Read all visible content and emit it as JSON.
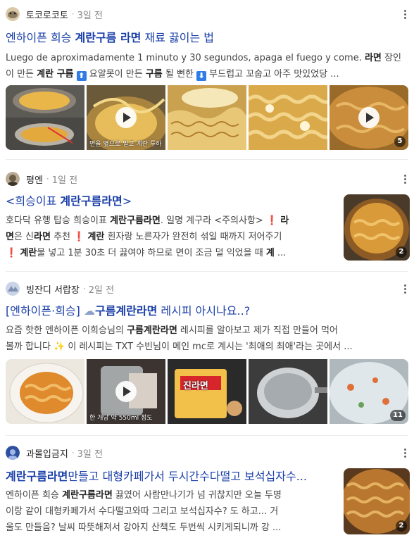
{
  "posts": [
    {
      "author": "토코로코토",
      "time": "3일 전",
      "title_parts": [
        "엔하이픈 희승 ",
        "계란구름 라면",
        " 재료 끓이는 법"
      ],
      "desc_line1_a": "Luego de aproximadamente 1 minuto y 30 segundos, apaga el fuego y come. ",
      "desc_line1_b": "라면",
      "desc_line1_c": " 장인",
      "desc_line2": [
        "이 만든 ",
        "계란 구름",
        " ",
        "⬆",
        " 요알못이 만든 ",
        "구름",
        " 될 뻔한 ",
        "⬇",
        " 부드럽고 꼬숩고 아주 맛있었당 ..."
      ],
      "images": [
        {
          "caption": "",
          "video": false
        },
        {
          "caption": "면을 옆으로 밀고 계란 투하",
          "video": true
        },
        {
          "caption": "",
          "video": false
        },
        {
          "caption": "",
          "video": false
        },
        {
          "caption": "",
          "video": true,
          "count": "5"
        }
      ]
    },
    {
      "author": "평엔",
      "time": "1일 전",
      "title_parts": [
        "<희승이표 ",
        "계란구름라면",
        ">"
      ],
      "desc_lines": [
        [
          "호다닥 유행 탑승 희승이표 ",
          "계란구름라면",
          ". 일명 계구라 <주의사항> ",
          "❗",
          " ",
          "라"
        ],
        [
          "면",
          "은 신",
          "라면",
          " 추천 ",
          "❗",
          " ",
          "계란",
          " 흰자랑 노른자가 완전히 섞일 때까지 저어주기"
        ],
        [
          "❗",
          " ",
          "계란",
          "물 넣고 1분 30초 더 끓여야 하므로 면이 조금 덜 익었을 때 ",
          "계",
          " ..."
        ]
      ],
      "thumb_count": "2"
    },
    {
      "author": "빙잔디 서랍장",
      "time": "2일 전",
      "title_parts": [
        "[엔하이픈·희승] ",
        "☁",
        "구름계란라면",
        " 레시피 아시나요..?"
      ],
      "desc_line1": [
        "요즘 핫한 엔하이픈 이희승님의 ",
        "구름계란라면",
        " 레시피를 알아보고 제가 직접 만들어 먹어"
      ],
      "desc_line2": "볼까 합니다 ✨ 이 레시피는 TXT 수빈님이 메인 mc로 계시는 '최애의 최애'라는 곳에서 ...",
      "images": [
        {
          "caption": "",
          "video": false
        },
        {
          "caption": "한 개당 약 550ml 정도",
          "video": true
        },
        {
          "caption": "",
          "video": false,
          "label": "진라면"
        },
        {
          "caption": "",
          "video": false
        },
        {
          "caption": "",
          "video": false,
          "count": "11"
        }
      ]
    },
    {
      "author": "과몰입금지",
      "time": "3일 전",
      "title_parts": [
        "계란구름라면",
        "만들고 대형카페가서 두시간수다떨고 보석십자수..."
      ],
      "desc_lines": [
        [
          "엔하이픈 희승 ",
          "계란구름라면",
          " 끓였어 사람만나기가 넘 귀찮지만 오늘 두명"
        ],
        [
          "이랑 같이 대형카페가서 수다떨고와따 그리고 보석십자수? 도 하고... 거"
        ],
        [
          "울도 만들음? 날씨 따뜻해져서 강아지 산책도 두번씩 시키게되니까 강 ..."
        ]
      ],
      "thumb_count": "2"
    }
  ],
  "icons": {
    "play": "play-icon",
    "more": "more-options-icon",
    "cloud": "cloud-emoji",
    "sparkles": "sparkles-emoji",
    "exclamation": "red-exclamation-emoji",
    "arrow_up": "up-arrow-emoji",
    "arrow_down": "down-arrow-emoji"
  },
  "colors": {
    "title": "#1a3fa8",
    "text": "#444444",
    "red": "#e23b3b"
  }
}
